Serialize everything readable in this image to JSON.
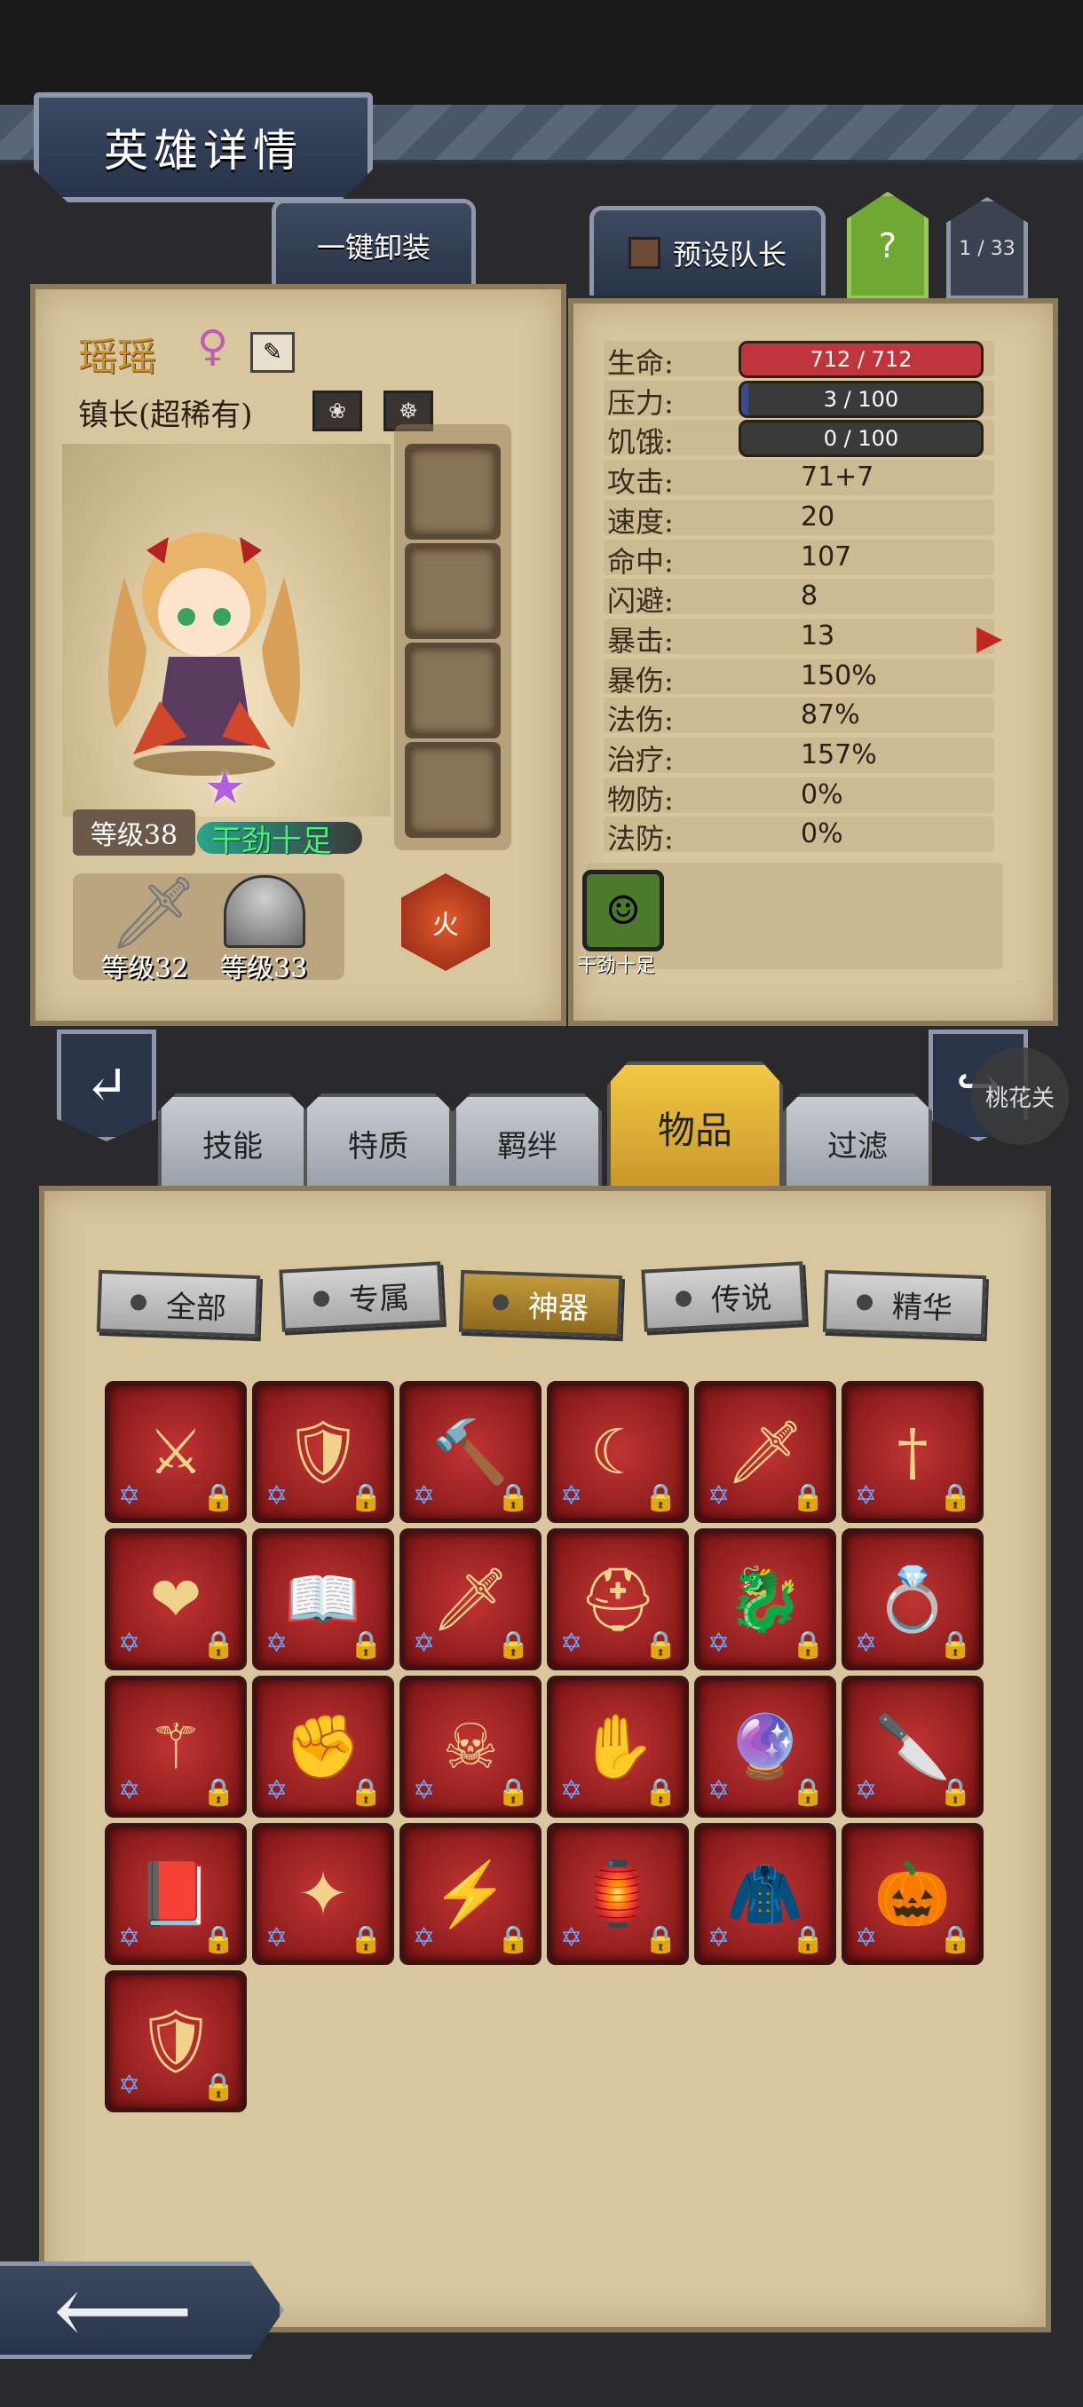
{
  "header": {
    "title": "英雄详情"
  },
  "top_tabs": {
    "unequip_all": "一键卸装",
    "preset_leader": "预设队长",
    "help": "?",
    "page_count": "1 / 33"
  },
  "hero": {
    "name": "瑶瑶",
    "gender_symbol": "♀",
    "title": "镇长(超稀有)",
    "level": "等级38",
    "mood": "干劲十足",
    "weapon_level": "等级32",
    "armor_level": "等级33",
    "element": "火",
    "trait_label": "干劲十足"
  },
  "stats": [
    {
      "label": "生命:",
      "value": "712 / 712",
      "kind": "bar",
      "color": "#c0353b",
      "fill": 1.0
    },
    {
      "label": "压力:",
      "value": "3 / 100",
      "kind": "bar",
      "color": "#3a4a8a",
      "fill": 0.03
    },
    {
      "label": "饥饿:",
      "value": "0 / 100",
      "kind": "bar",
      "color": "#3a3a3a",
      "fill": 0.0
    },
    {
      "label": "攻击:",
      "value": "71+7"
    },
    {
      "label": "速度:",
      "value": "20"
    },
    {
      "label": "命中:",
      "value": "107"
    },
    {
      "label": "闪避:",
      "value": "8"
    },
    {
      "label": "暴击:",
      "value": "13"
    },
    {
      "label": "暴伤:",
      "value": "150%"
    },
    {
      "label": "法伤:",
      "value": "87%"
    },
    {
      "label": "治疗:",
      "value": "157%"
    },
    {
      "label": "物防:",
      "value": "0%"
    },
    {
      "label": "法防:",
      "value": "0%"
    }
  ],
  "bottom_tabs": [
    "技能",
    "特质",
    "羁绊",
    "物品",
    "过滤"
  ],
  "active_tab_index": 3,
  "side_button": "桃花关",
  "filters": [
    "全部",
    "专属",
    "神器",
    "传说",
    "精华"
  ],
  "active_filter_index": 2,
  "items": [
    {
      "icon": "golden-axe-icon",
      "glyph": "⚔"
    },
    {
      "icon": "laurel-shield-icon",
      "glyph": "🛡"
    },
    {
      "icon": "war-hammer-icon",
      "glyph": "🔨"
    },
    {
      "icon": "dark-scythe-icon",
      "glyph": "☾"
    },
    {
      "icon": "crimson-blade-icon",
      "glyph": "🗡"
    },
    {
      "icon": "crystal-sword-icon",
      "glyph": "†"
    },
    {
      "icon": "flaming-heart-icon",
      "glyph": "❤"
    },
    {
      "icon": "winged-tome-icon",
      "glyph": "📖"
    },
    {
      "icon": "emerald-dagger-icon",
      "glyph": "🗡"
    },
    {
      "icon": "golden-helm-icon",
      "glyph": "⛑"
    },
    {
      "icon": "dragon-armor-icon",
      "glyph": "🐉"
    },
    {
      "icon": "gem-ring-icon",
      "glyph": "💍"
    },
    {
      "icon": "orb-staff-icon",
      "glyph": "⚚"
    },
    {
      "icon": "golden-gauntlet-icon",
      "glyph": "✊"
    },
    {
      "icon": "skull-scythe-icon",
      "glyph": "☠"
    },
    {
      "icon": "steel-gauntlet-icon",
      "glyph": "✋"
    },
    {
      "icon": "magic-orb-icon",
      "glyph": "🔮"
    },
    {
      "icon": "poison-knife-icon",
      "glyph": "🔪"
    },
    {
      "icon": "spiked-book-icon",
      "glyph": "📕"
    },
    {
      "icon": "shuriken-icon",
      "glyph": "✦"
    },
    {
      "icon": "lightning-spear-icon",
      "glyph": "⚡"
    },
    {
      "icon": "lantern-icon",
      "glyph": "🏮"
    },
    {
      "icon": "cloak-icon",
      "glyph": "🧥"
    },
    {
      "icon": "pumpkin-ring-icon",
      "glyph": "🎃"
    },
    {
      "icon": "arcane-shield-icon",
      "glyph": "🛡"
    }
  ]
}
